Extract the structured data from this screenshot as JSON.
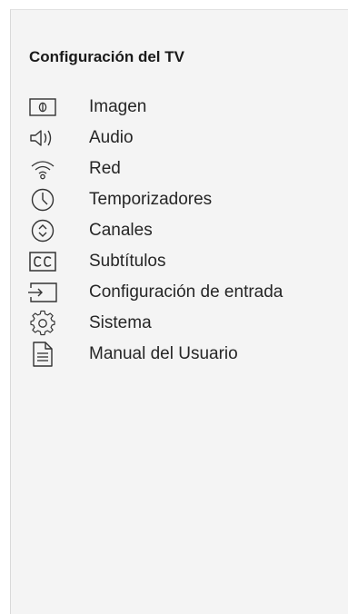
{
  "menu": {
    "title": "Configuración del TV",
    "items": [
      {
        "label": "Imagen",
        "icon": "picture-icon"
      },
      {
        "label": "Audio",
        "icon": "speaker-icon"
      },
      {
        "label": "Red",
        "icon": "wifi-icon"
      },
      {
        "label": "Temporizadores",
        "icon": "clock-icon"
      },
      {
        "label": "Canales",
        "icon": "channel-updown-icon"
      },
      {
        "label": "Subtítulos",
        "icon": "closed-caption-icon"
      },
      {
        "label": "Configuración de entrada",
        "icon": "input-icon"
      },
      {
        "label": "Sistema",
        "icon": "gear-icon"
      },
      {
        "label": "Manual del Usuario",
        "icon": "document-icon"
      }
    ]
  }
}
